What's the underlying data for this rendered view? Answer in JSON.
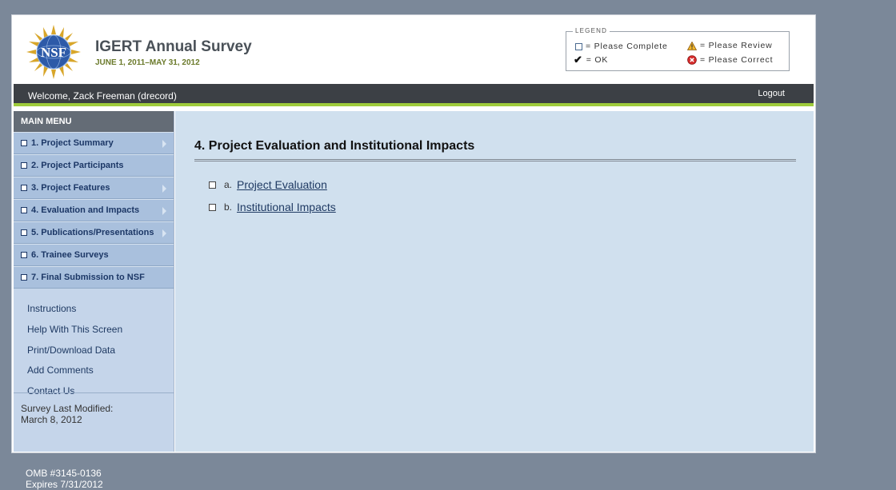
{
  "header": {
    "logo_text": "NSF",
    "title": "IGERT Annual Survey",
    "dates": "JUNE 1, 2011–MAY 31, 2012"
  },
  "legend": {
    "title": "LEGEND",
    "items": [
      {
        "icon": "empty-box-icon",
        "label": "= Please Complete"
      },
      {
        "icon": "warning-triangle-icon",
        "label": "= Please Review"
      },
      {
        "icon": "checkmark-icon",
        "label": "= OK"
      },
      {
        "icon": "error-circle-icon",
        "label": "= Please Correct"
      }
    ]
  },
  "topbar": {
    "welcome": "Welcome, Zack Freeman (drecord)",
    "logout": "Logout"
  },
  "sidebar": {
    "header": "MAIN MENU",
    "items": [
      {
        "label": "1. Project Summary",
        "has_arrow": true
      },
      {
        "label": "2. Project Participants",
        "has_arrow": false
      },
      {
        "label": "3. Project Features",
        "has_arrow": true
      },
      {
        "label": "4. Evaluation and Impacts",
        "has_arrow": true
      },
      {
        "label": "5. Publications/Presentations",
        "has_arrow": true
      },
      {
        "label": "6. Trainee Surveys",
        "has_arrow": false
      },
      {
        "label": "7. Final Submission to NSF",
        "has_arrow": false
      }
    ],
    "links": [
      "Instructions",
      "Help With This Screen",
      "Print/Download Data",
      "Add Comments",
      "Contact Us"
    ],
    "modified_label": "Survey Last Modified:",
    "modified_date": "March 8, 2012"
  },
  "main": {
    "title": "4. Project Evaluation and Institutional Impacts",
    "items": [
      {
        "prefix": "a.",
        "label": "Project Evaluation"
      },
      {
        "prefix": "b.",
        "label": "Institutional Impacts"
      }
    ]
  },
  "footer": {
    "omb": "OMB #3145-0136",
    "expires": "Expires 7/31/2012"
  },
  "colors": {
    "accent_green": "#9fcc3b",
    "topbar": "#3c4045",
    "sidebar_item": "#a9c0dd",
    "main_bg": "#d0e0ee"
  }
}
